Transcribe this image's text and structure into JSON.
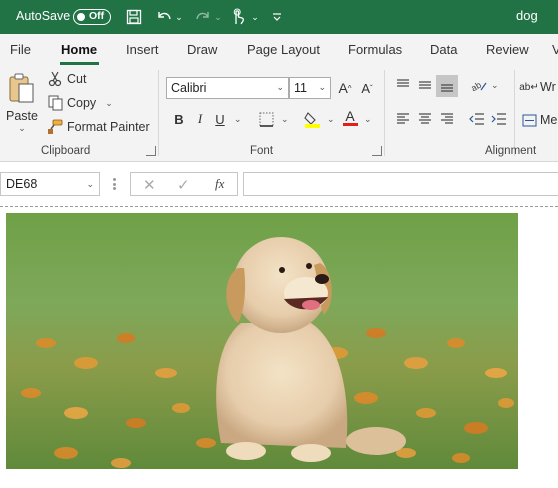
{
  "titlebar": {
    "autosave_label": "AutoSave",
    "autosave_state": "Off",
    "user_name": "dog",
    "icons": [
      "save-icon",
      "undo-icon",
      "redo-icon",
      "touch-mode-icon",
      "customize-qat-icon"
    ]
  },
  "tabs": [
    {
      "label": "File",
      "active": false
    },
    {
      "label": "Home",
      "active": true
    },
    {
      "label": "Insert",
      "active": false
    },
    {
      "label": "Draw",
      "active": false
    },
    {
      "label": "Page Layout",
      "active": false
    },
    {
      "label": "Formulas",
      "active": false
    },
    {
      "label": "Data",
      "active": false
    },
    {
      "label": "Review",
      "active": false
    }
  ],
  "ribbon": {
    "clipboard": {
      "paste_label": "Paste",
      "cut_label": "Cut",
      "copy_label": "Copy",
      "format_painter_label": "Format Painter",
      "group_label": "Clipboard"
    },
    "font": {
      "font_name": "Calibri",
      "font_size": "11",
      "group_label": "Font",
      "bold": "B",
      "italic": "I",
      "underline": "U",
      "font_color_accent": "#e0201b",
      "highlight_accent": "#ffff00"
    },
    "alignment": {
      "group_label": "Alignment",
      "wrap_text_label": "Wr",
      "merge_label": "Me"
    }
  },
  "formula_bar": {
    "name_box": "DE68",
    "fx_label": "fx",
    "formula_value": ""
  },
  "colors": {
    "brand_green": "#217346",
    "ribbon_bg": "#f3f3f3"
  }
}
